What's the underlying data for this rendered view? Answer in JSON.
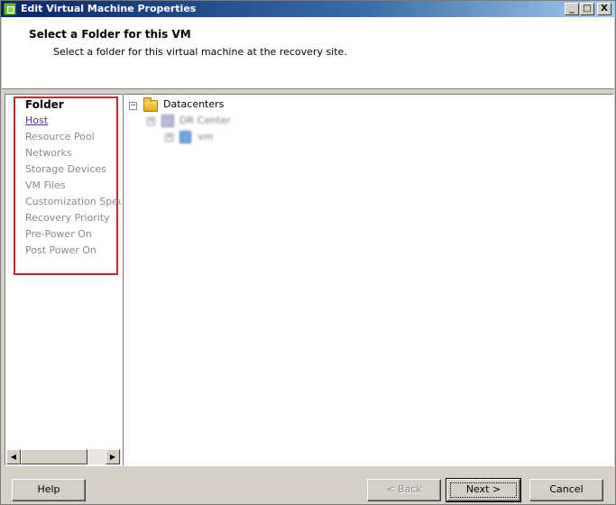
{
  "window": {
    "title": "Edit Virtual Machine Properties",
    "controls": {
      "minimize": "_",
      "maximize": "□",
      "close": "X"
    }
  },
  "header": {
    "title": "Select a Folder for this VM",
    "subtitle": "Select a folder for this virtual machine at the recovery site."
  },
  "nav": {
    "heading": "Folder",
    "items": [
      {
        "label": "Host",
        "state": "link"
      },
      {
        "label": "Resource Pool",
        "state": "disabled"
      },
      {
        "label": "Networks",
        "state": "disabled"
      },
      {
        "label": "Storage Devices",
        "state": "disabled"
      },
      {
        "label": "VM Files",
        "state": "disabled"
      },
      {
        "label": "Customization Specs",
        "state": "disabled"
      },
      {
        "label": "Recovery Priority",
        "state": "disabled"
      },
      {
        "label": "Pre-Power On",
        "state": "disabled"
      },
      {
        "label": "Post Power On",
        "state": "disabled"
      }
    ],
    "highlight_color": "#c0282d"
  },
  "tree": {
    "root": {
      "label": "Datacenters",
      "toggle": "−",
      "icon": "folder-icon"
    },
    "child": {
      "label": "DR Center",
      "toggle": "+",
      "icon": "datacenter-icon"
    },
    "grandchild": {
      "label": "vm",
      "toggle": "+",
      "icon": "vm-folder-icon"
    }
  },
  "buttons": {
    "help": "Help",
    "back": "< Back",
    "next": "Next >",
    "cancel": "Cancel"
  },
  "scrollbar": {
    "left_arrow": "◀",
    "right_arrow": "▶"
  }
}
